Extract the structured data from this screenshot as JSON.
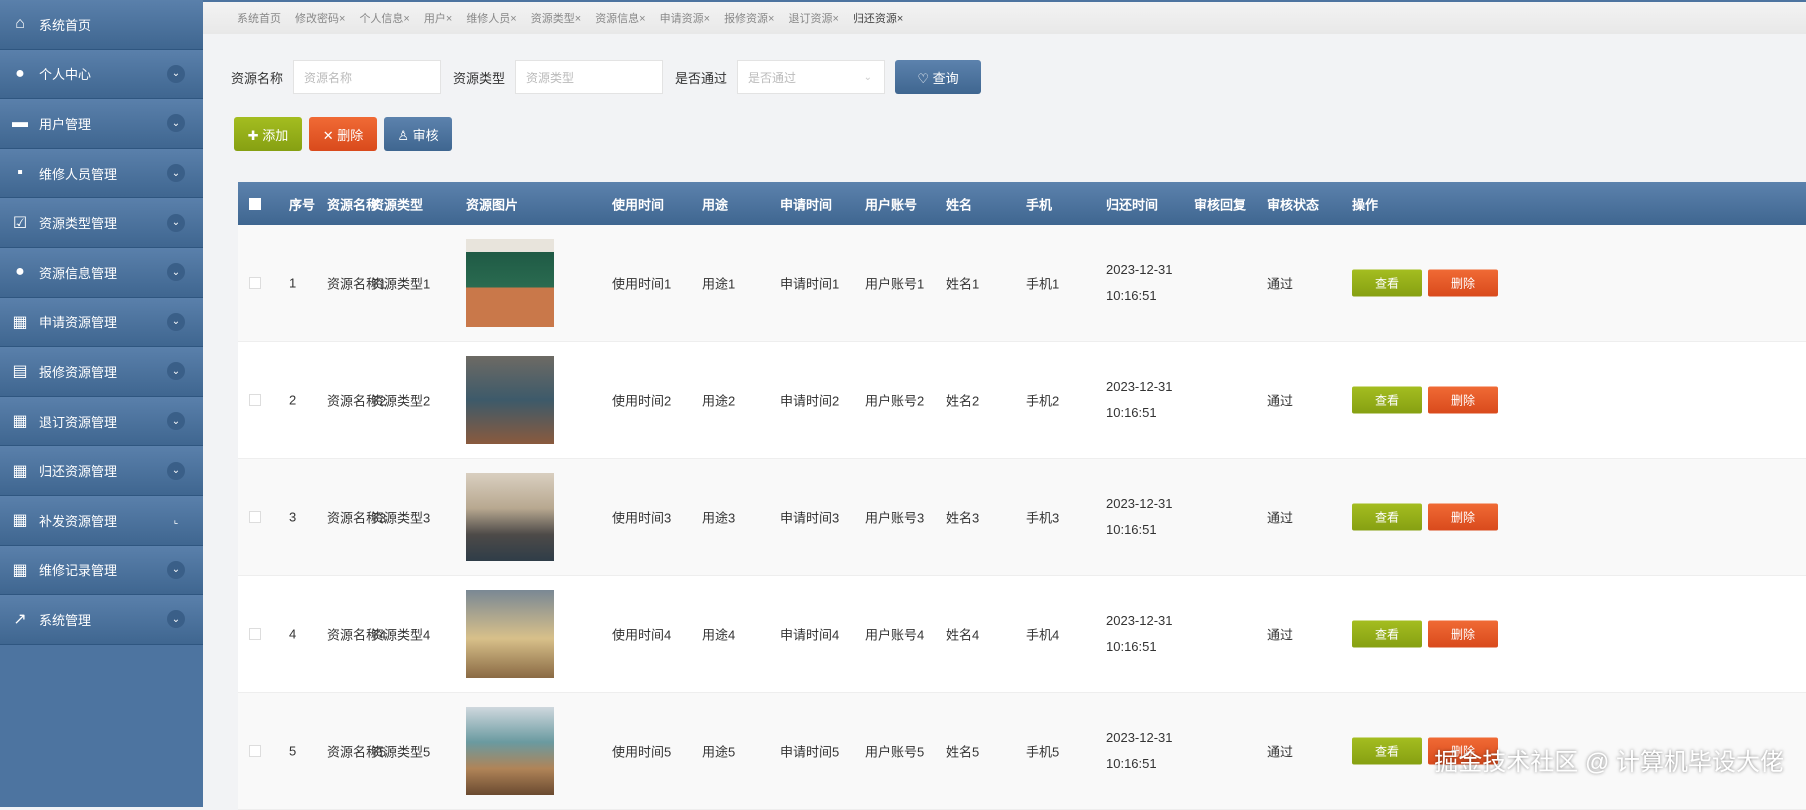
{
  "sidebar": {
    "items": [
      {
        "label": "系统首页",
        "icon": "home-icon",
        "glyph": "⌂",
        "chev": ""
      },
      {
        "label": "个人中心",
        "icon": "user-icon",
        "glyph": "●",
        "chev": "⌄"
      },
      {
        "label": "用户管理",
        "icon": "briefcase-icon",
        "glyph": "▬",
        "chev": "⌄"
      },
      {
        "label": "维修人员管理",
        "icon": "chat-icon",
        "glyph": "▪",
        "chev": "⌄"
      },
      {
        "label": "资源类型管理",
        "icon": "clipboard-check-icon",
        "glyph": "☑",
        "chev": "⌄"
      },
      {
        "label": "资源信息管理",
        "icon": "bulb-icon",
        "glyph": "●",
        "chev": "⌄"
      },
      {
        "label": "申请资源管理",
        "icon": "grid-icon",
        "glyph": "▦",
        "chev": "⌄"
      },
      {
        "label": "报修资源管理",
        "icon": "clipboard-icon",
        "glyph": "▤",
        "chev": "⌄"
      },
      {
        "label": "退订资源管理",
        "icon": "grid-icon",
        "glyph": "▦",
        "chev": "⌄"
      },
      {
        "label": "归还资源管理",
        "icon": "grid-icon",
        "glyph": "▦",
        "chev": "⌄"
      },
      {
        "label": "补发资源管理",
        "icon": "grid-icon",
        "glyph": "▦",
        "chev": "⌞"
      },
      {
        "label": "维修记录管理",
        "icon": "grid-icon",
        "glyph": "▦",
        "chev": "⌄"
      },
      {
        "label": "系统管理",
        "icon": "chart-icon",
        "glyph": "↗",
        "chev": "⌄"
      }
    ]
  },
  "tabs": [
    "系统首页",
    "修改密码×",
    "个人信息×",
    "用户×",
    "维修人员×",
    "资源类型×",
    "资源信息×",
    "申请资源×",
    "报修资源×",
    "退订资源×",
    "归还资源×"
  ],
  "search": {
    "name_label": "资源名称",
    "name_placeholder": "资源名称",
    "type_label": "资源类型",
    "type_placeholder": "资源类型",
    "pass_label": "是否通过",
    "pass_placeholder": "是否通过",
    "query": "♡ 查询"
  },
  "actions": {
    "add": "✚ 添加",
    "delete": "✕ 删除",
    "audit": "♙ 审核"
  },
  "columns": [
    "序号",
    "资源名称",
    "资源类型",
    "资源图片",
    "使用时间",
    "用途",
    "申请时间",
    "用户账号",
    "姓名",
    "手机",
    "归还时间",
    "审核回复",
    "审核状态",
    "操作"
  ],
  "rows": [
    {
      "no": "1",
      "name": "资源名称1",
      "type": "资源类型1",
      "use_time": "使用时间1",
      "purpose": "用途1",
      "apply_time": "申请时间1",
      "account": "用户账号1",
      "person": "姓名1",
      "phone": "手机1",
      "return_date": "2023-12-31",
      "return_time": "10:16:51",
      "reply": "",
      "status": "通过"
    },
    {
      "no": "2",
      "name": "资源名称2",
      "type": "资源类型2",
      "use_time": "使用时间2",
      "purpose": "用途2",
      "apply_time": "申请时间2",
      "account": "用户账号2",
      "person": "姓名2",
      "phone": "手机2",
      "return_date": "2023-12-31",
      "return_time": "10:16:51",
      "reply": "",
      "status": "通过"
    },
    {
      "no": "3",
      "name": "资源名称3",
      "type": "资源类型3",
      "use_time": "使用时间3",
      "purpose": "用途3",
      "apply_time": "申请时间3",
      "account": "用户账号3",
      "person": "姓名3",
      "phone": "手机3",
      "return_date": "2023-12-31",
      "return_time": "10:16:51",
      "reply": "",
      "status": "通过"
    },
    {
      "no": "4",
      "name": "资源名称4",
      "type": "资源类型4",
      "use_time": "使用时间4",
      "purpose": "用途4",
      "apply_time": "申请时间4",
      "account": "用户账号4",
      "person": "姓名4",
      "phone": "手机4",
      "return_date": "2023-12-31",
      "return_time": "10:16:51",
      "reply": "",
      "status": "通过"
    },
    {
      "no": "5",
      "name": "资源名称5",
      "type": "资源类型5",
      "use_time": "使用时间5",
      "purpose": "用途5",
      "apply_time": "申请时间5",
      "account": "用户账号5",
      "person": "姓名5",
      "phone": "手机5",
      "return_date": "2023-12-31",
      "return_time": "10:16:51",
      "reply": "",
      "status": "通过"
    }
  ],
  "row_buttons": {
    "view": "查看",
    "delete": "删除"
  },
  "watermark": "掘金技术社区 @ 计算机毕设大佬"
}
